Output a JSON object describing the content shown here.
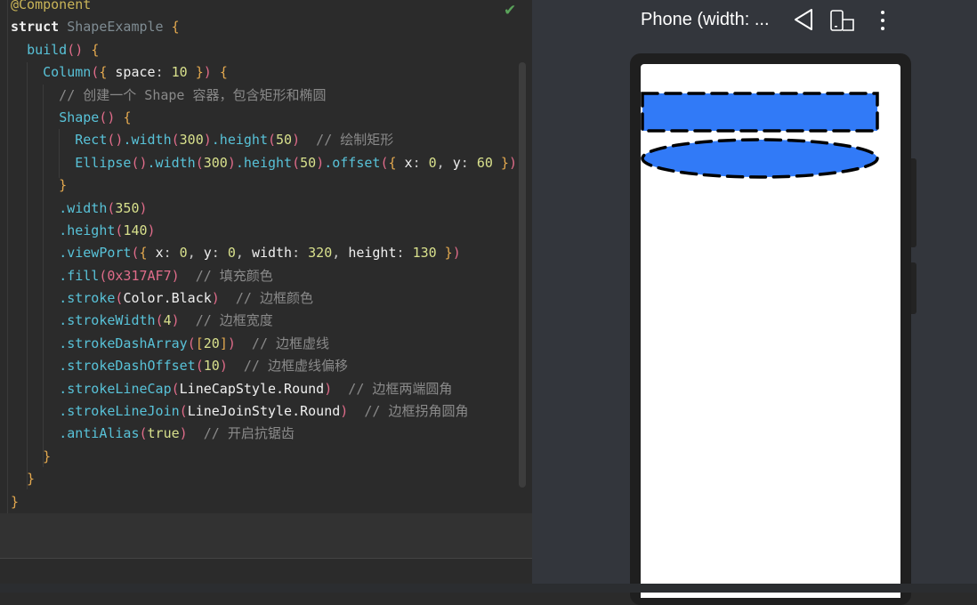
{
  "editor": {
    "lines": [
      [
        [
          "@Component",
          "ann"
        ]
      ],
      [
        [
          "struct ",
          "kw"
        ],
        [
          "ShapeExample ",
          "cls"
        ],
        [
          "{",
          "br"
        ]
      ],
      [
        [
          "  ",
          " "
        ],
        [
          "build",
          "fn"
        ],
        [
          "() ",
          "pn"
        ],
        [
          "{",
          "br"
        ]
      ],
      [
        [
          "    ",
          " "
        ],
        [
          "Column",
          "fn"
        ],
        [
          "(",
          "pn"
        ],
        [
          "{ ",
          "br"
        ],
        [
          "space",
          "prop"
        ],
        [
          ": ",
          "plain"
        ],
        [
          "10",
          "num"
        ],
        [
          " }",
          "br"
        ],
        [
          ") ",
          "pn"
        ],
        [
          "{",
          "br"
        ]
      ],
      [
        [
          "      // 创建一个 Shape 容器，包含矩形和椭圆",
          "cm"
        ]
      ],
      [
        [
          "      ",
          " "
        ],
        [
          "Shape",
          "fn"
        ],
        [
          "() ",
          "pn"
        ],
        [
          "{",
          "br"
        ]
      ],
      [
        [
          "        ",
          " "
        ],
        [
          "Rect",
          "fn"
        ],
        [
          "()",
          "pn"
        ],
        [
          ".width",
          "fn"
        ],
        [
          "(",
          "pn"
        ],
        [
          "300",
          "num"
        ],
        [
          ")",
          "pn"
        ],
        [
          ".height",
          "fn"
        ],
        [
          "(",
          "pn"
        ],
        [
          "50",
          "num"
        ],
        [
          ")",
          "pn"
        ],
        [
          "  // 绘制矩形",
          "cm"
        ]
      ],
      [
        [
          "        ",
          " "
        ],
        [
          "Ellipse",
          "fn"
        ],
        [
          "()",
          "pn"
        ],
        [
          ".width",
          "fn"
        ],
        [
          "(",
          "pn"
        ],
        [
          "300",
          "num"
        ],
        [
          ")",
          "pn"
        ],
        [
          ".height",
          "fn"
        ],
        [
          "(",
          "pn"
        ],
        [
          "50",
          "num"
        ],
        [
          ")",
          "pn"
        ],
        [
          ".offset",
          "fn"
        ],
        [
          "(",
          "pn"
        ],
        [
          "{ ",
          "br"
        ],
        [
          "x",
          "prop"
        ],
        [
          ": ",
          "plain"
        ],
        [
          "0",
          "num"
        ],
        [
          ", ",
          "plain"
        ],
        [
          "y",
          "prop"
        ],
        [
          ": ",
          "plain"
        ],
        [
          "60",
          "num"
        ],
        [
          " }",
          "br"
        ],
        [
          ")",
          "pn"
        ]
      ],
      [
        [
          "      }",
          "br"
        ]
      ],
      [
        [
          "      ",
          " "
        ],
        [
          ".width",
          "fn"
        ],
        [
          "(",
          "pn"
        ],
        [
          "350",
          "num"
        ],
        [
          ")",
          "pn"
        ]
      ],
      [
        [
          "      ",
          " "
        ],
        [
          ".height",
          "fn"
        ],
        [
          "(",
          "pn"
        ],
        [
          "140",
          "num"
        ],
        [
          ")",
          "pn"
        ]
      ],
      [
        [
          "      ",
          " "
        ],
        [
          ".viewPort",
          "fn"
        ],
        [
          "(",
          "pn"
        ],
        [
          "{ ",
          "br"
        ],
        [
          "x",
          "prop"
        ],
        [
          ": ",
          "plain"
        ],
        [
          "0",
          "num"
        ],
        [
          ", ",
          "plain"
        ],
        [
          "y",
          "prop"
        ],
        [
          ": ",
          "plain"
        ],
        [
          "0",
          "num"
        ],
        [
          ", ",
          "plain"
        ],
        [
          "width",
          "prop"
        ],
        [
          ": ",
          "plain"
        ],
        [
          "320",
          "num"
        ],
        [
          ", ",
          "plain"
        ],
        [
          "height",
          "prop"
        ],
        [
          ": ",
          "plain"
        ],
        [
          "130",
          "num"
        ],
        [
          " }",
          "br"
        ],
        [
          ")",
          "pn"
        ]
      ],
      [
        [
          "      ",
          " "
        ],
        [
          ".fill",
          "fn"
        ],
        [
          "(",
          "pn"
        ],
        [
          "0x317AF7",
          "pn"
        ],
        [
          ")",
          "pn"
        ],
        [
          "  // 填充颜色",
          "cm"
        ]
      ],
      [
        [
          "      ",
          " "
        ],
        [
          ".stroke",
          "fn"
        ],
        [
          "(",
          "pn"
        ],
        [
          "Color.Black",
          "prop"
        ],
        [
          ")",
          "pn"
        ],
        [
          "  // 边框颜色",
          "cm"
        ]
      ],
      [
        [
          "      ",
          " "
        ],
        [
          ".strokeWidth",
          "fn"
        ],
        [
          "(",
          "pn"
        ],
        [
          "4",
          "num"
        ],
        [
          ")",
          "pn"
        ],
        [
          "  // 边框宽度",
          "cm"
        ]
      ],
      [
        [
          "      ",
          " "
        ],
        [
          ".strokeDashArray",
          "fn"
        ],
        [
          "(",
          "pn"
        ],
        [
          "[",
          "br"
        ],
        [
          "20",
          "num"
        ],
        [
          "]",
          "br"
        ],
        [
          ")",
          "pn"
        ],
        [
          "  // 边框虚线",
          "cm"
        ]
      ],
      [
        [
          "      ",
          " "
        ],
        [
          ".strokeDashOffset",
          "fn"
        ],
        [
          "(",
          "pn"
        ],
        [
          "10",
          "num"
        ],
        [
          ")",
          "pn"
        ],
        [
          "  // 边框虚线偏移",
          "cm"
        ]
      ],
      [
        [
          "      ",
          " "
        ],
        [
          ".strokeLineCap",
          "fn"
        ],
        [
          "(",
          "pn"
        ],
        [
          "LineCapStyle.Round",
          "prop"
        ],
        [
          ")",
          "pn"
        ],
        [
          "  // 边框两端圆角",
          "cm"
        ]
      ],
      [
        [
          "      ",
          " "
        ],
        [
          ".strokeLineJoin",
          "fn"
        ],
        [
          "(",
          "pn"
        ],
        [
          "LineJoinStyle.Round",
          "prop"
        ],
        [
          ")",
          "pn"
        ],
        [
          "  // 边框拐角圆角",
          "cm"
        ]
      ],
      [
        [
          "      ",
          " "
        ],
        [
          ".antiAlias",
          "fn"
        ],
        [
          "(",
          "pn"
        ],
        [
          "true",
          "num"
        ],
        [
          ")",
          "pn"
        ],
        [
          "  // 开启抗锯齿",
          "cm"
        ]
      ],
      [
        [
          "    }",
          "br"
        ]
      ],
      [
        [
          "  }",
          "br"
        ]
      ],
      [
        [
          "}",
          "br"
        ]
      ]
    ]
  },
  "preview": {
    "title": "Phone (width: ...",
    "fill_color": "#317AF7",
    "stroke_color": "#000000"
  }
}
